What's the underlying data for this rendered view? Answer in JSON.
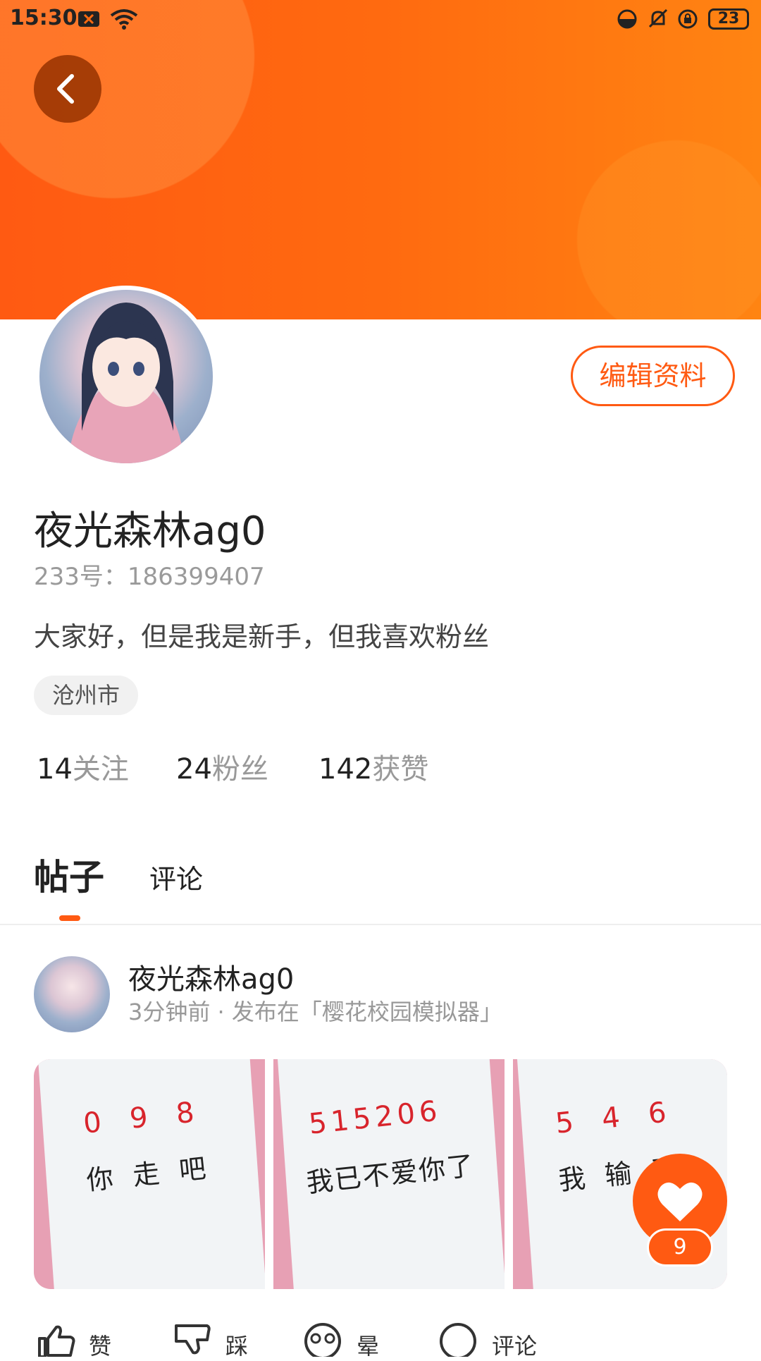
{
  "status_bar": {
    "time": "15:30",
    "battery": "23"
  },
  "profile": {
    "edit_label": "编辑资料",
    "username": "夜光森林ag0",
    "uid_label": "233号：",
    "uid": "186399407",
    "bio": "大家好，但是我是新手，但我喜欢粉丝",
    "location": "沧州市",
    "stats": [
      {
        "num": "14",
        "label": "关注"
      },
      {
        "num": "24",
        "label": "粉丝"
      },
      {
        "num": "142",
        "label": "获赞"
      }
    ]
  },
  "tabs": {
    "posts": "帖子",
    "comments": "评论"
  },
  "post": {
    "author": "夜光森林ag0",
    "meta": "3分钟前 · 发布在「樱花校园模拟器」",
    "images": [
      {
        "red": "0 9 8",
        "black": "你 走 吧"
      },
      {
        "red": "515206",
        "black": "我已不爱你了"
      },
      {
        "red": "5 4 6",
        "black": "我 输 了"
      }
    ],
    "like_count": "9",
    "actions": {
      "like": "赞",
      "dislike": "踩",
      "dizzy": "晕",
      "comment": "评论"
    }
  },
  "colors": {
    "accent": "#ff5a12"
  }
}
